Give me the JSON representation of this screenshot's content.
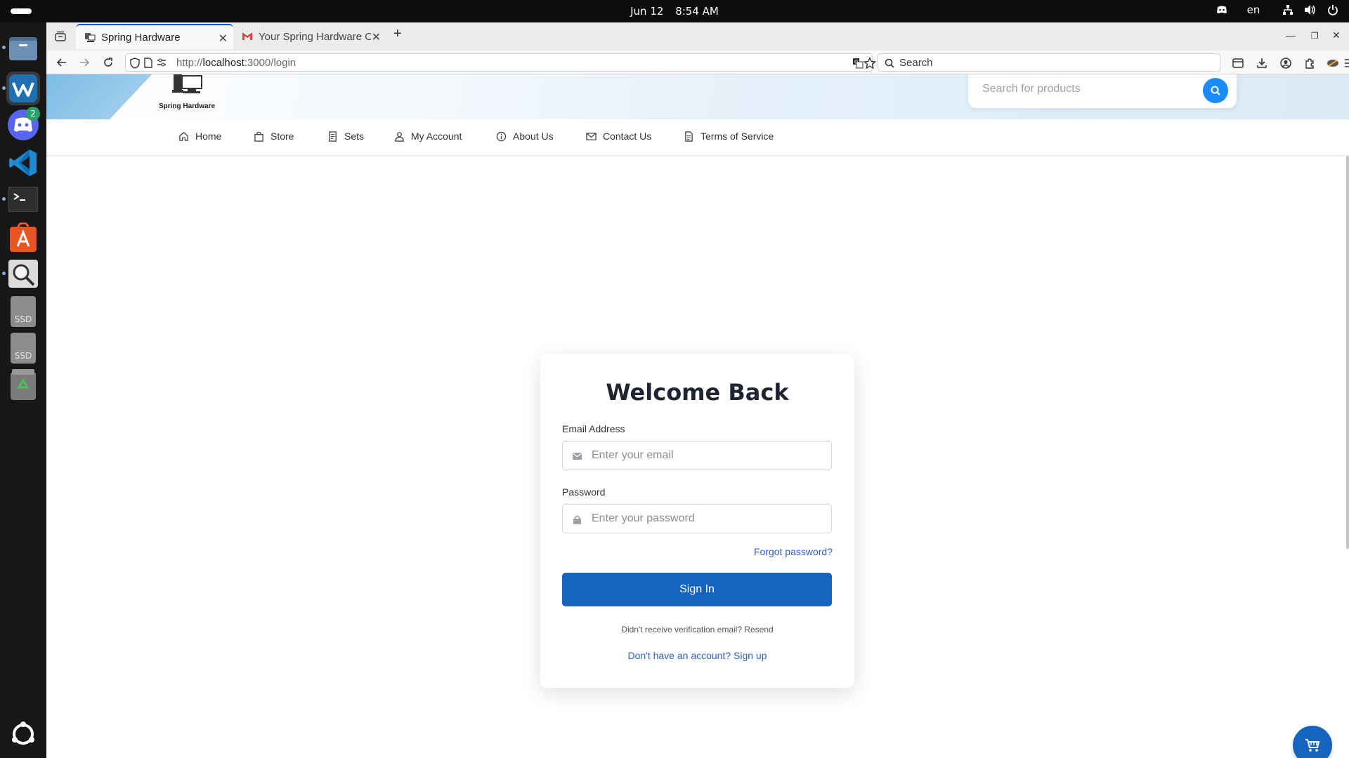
{
  "system": {
    "date": "Jun 12",
    "time": "8:54 AM",
    "language": "en",
    "discord_badge": "2"
  },
  "dock": {
    "items": [
      "files",
      "windsurf",
      "discord",
      "vscode",
      "terminal",
      "app-center",
      "image-viewer",
      "ssd-1",
      "ssd-2",
      "trash"
    ],
    "ssd_label": "SSD"
  },
  "browser": {
    "tabs": [
      {
        "title": "Spring Hardware",
        "active": true
      },
      {
        "title": "Your Spring Hardware Or",
        "active": false
      }
    ],
    "url_prefix": "http://",
    "url_host": "localhost",
    "url_rest": ":3000/login",
    "search_placeholder": "Search"
  },
  "site": {
    "brand": "Spring Hardware",
    "search_placeholder": "Search for products",
    "nav": [
      {
        "label": "Home",
        "icon": "home-icon"
      },
      {
        "label": "Store",
        "icon": "bag-icon"
      },
      {
        "label": "Sets",
        "icon": "sets-icon"
      },
      {
        "label": "My Account",
        "icon": "user-icon"
      },
      {
        "label": "About Us",
        "icon": "info-icon"
      },
      {
        "label": "Contact Us",
        "icon": "mail-icon"
      },
      {
        "label": "Terms of Service",
        "icon": "document-icon"
      }
    ]
  },
  "login": {
    "heading": "Welcome Back",
    "email_label": "Email Address",
    "email_placeholder": "Enter your email",
    "password_label": "Password",
    "password_placeholder": "Enter your password",
    "forgot": "Forgot password?",
    "submit": "Sign In",
    "resend": "Didn't receive verification email? Resend",
    "signup": "Don't have an account? Sign up"
  },
  "colors": {
    "primary": "#1565c0",
    "link": "#2f62c9",
    "search_button": "#1a8cff"
  }
}
